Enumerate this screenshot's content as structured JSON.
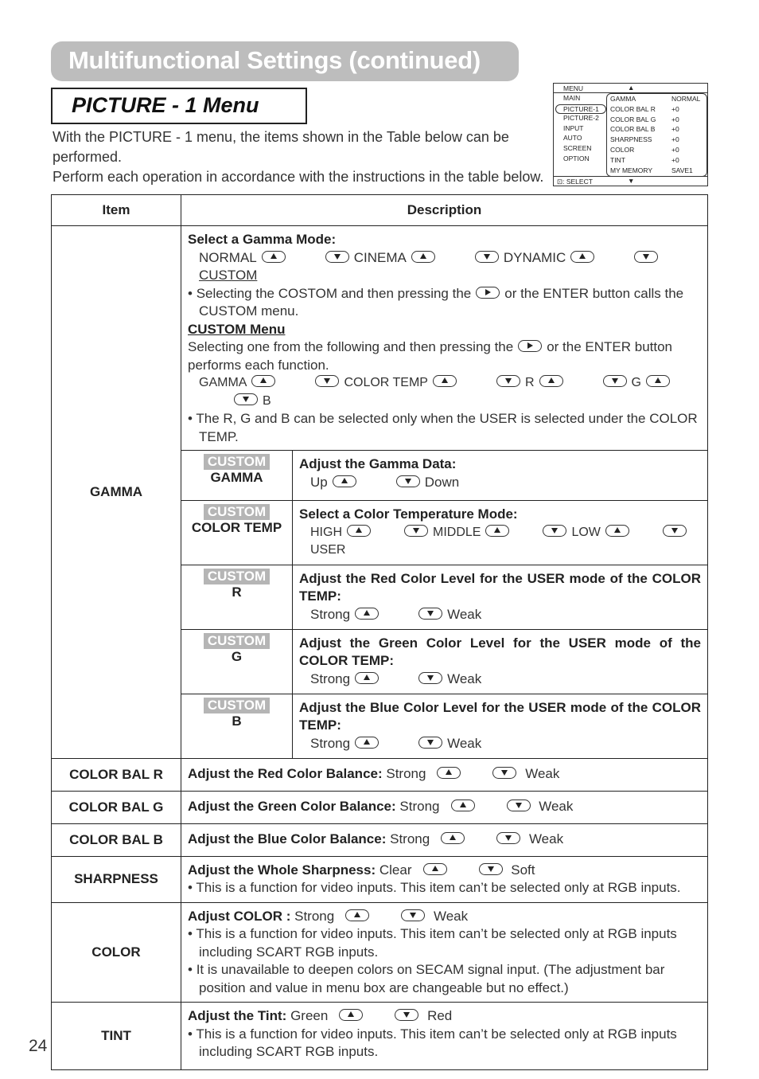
{
  "page": {
    "title": "Multifunctional Settings (continued)",
    "subtitle": "PICTURE - 1 Menu",
    "intro": [
      "With the PICTURE - 1 menu, the items shown in the Table below can be performed.",
      "Perform each operation in accordance with the instructions in the table below."
    ],
    "page_number": "24"
  },
  "osd_menu": {
    "header": "MENU",
    "up_arrow": "▲",
    "down_arrow": "▼",
    "footer": ": SELECT",
    "left_items": [
      "MAIN",
      "PICTURE-1",
      "PICTURE-2",
      "INPUT",
      "AUTO",
      "SCREEN",
      "OPTION"
    ],
    "selected_left": "PICTURE-1",
    "right_items": [
      {
        "key": "GAMMA",
        "value": "NORMAL"
      },
      {
        "key": "COLOR BAL R",
        "value": "+0"
      },
      {
        "key": "COLOR BAL G",
        "value": "+0"
      },
      {
        "key": "COLOR BAL B",
        "value": "+0"
      },
      {
        "key": "SHARPNESS",
        "value": "+0"
      },
      {
        "key": "COLOR",
        "value": "+0"
      },
      {
        "key": "TINT",
        "value": "+0"
      },
      {
        "key": "MY MEMORY",
        "value": "SAVE1"
      }
    ]
  },
  "table": {
    "headers": {
      "item": "Item",
      "description": "Description"
    },
    "gamma": {
      "item": "GAMMA",
      "select_title": "Select a Gamma Mode:",
      "modes": [
        "NORMAL",
        "CINEMA",
        "DYNAMIC",
        "CUSTOM"
      ],
      "note1_a": "Selecting the COSTOM and then pressing the",
      "note1_b": "or the ENTER button calls the CUSTOM menu.",
      "custom_menu_title": "CUSTOM Menu",
      "custom_text_a": "Selecting one from the following and then pressing the",
      "custom_text_b": "or the ENTER button performs each function.",
      "custom_items": [
        "GAMMA",
        "COLOR TEMP",
        "R",
        "G",
        "B"
      ],
      "note2": "The R, G and B can be selected only when the USER is selected under the COLOR TEMP.",
      "custom_tag": "CUSTOM",
      "sub_rows": [
        {
          "item": "GAMMA",
          "title": "Adjust the Gamma Data:",
          "up": "Up",
          "down": "Down"
        },
        {
          "item": "COLOR TEMP",
          "title": "Select a Color Temperature Mode:",
          "modes": [
            "HIGH",
            "MIDDLE",
            "LOW",
            "USER"
          ]
        },
        {
          "item": "R",
          "title": "Adjust the Red Color Level for the USER mode of the COLOR TEMP:",
          "up": "Strong",
          "down": "Weak"
        },
        {
          "item": "G",
          "title": "Adjust the Green Color Level for the USER mode of the COLOR TEMP:",
          "up": "Strong",
          "down": "Weak"
        },
        {
          "item": "B",
          "title": "Adjust the Blue Color Level for the USER mode of the COLOR TEMP:",
          "up": "Strong",
          "down": "Weak"
        }
      ]
    },
    "rows": [
      {
        "item": "COLOR BAL R",
        "title": "Adjust the Red Color Balance:",
        "up": "Strong",
        "down": "Weak"
      },
      {
        "item": "COLOR BAL G",
        "title": "Adjust the Green Color Balance:",
        "up": "Strong",
        "down": "Weak"
      },
      {
        "item": "COLOR BAL B",
        "title": "Adjust the Blue Color Balance:",
        "up": "Strong",
        "down": "Weak"
      },
      {
        "item": "SHARPNESS",
        "title": "Adjust the Whole Sharpness:",
        "up": "Clear",
        "down": "Soft",
        "notes": [
          "This is a function for video inputs. This item can’t be selected only at RGB inputs."
        ]
      },
      {
        "item": "COLOR",
        "title": "Adjust COLOR :",
        "up": "Strong",
        "down": "Weak",
        "notes": [
          "This is a function for video inputs. This item can’t be selected only at  RGB inputs including SCART RGB inputs.",
          "It is unavailable to deepen colors on SECAM signal input. (The adjustment bar position and value in menu box are changeable but no effect.)"
        ]
      },
      {
        "item": "TINT",
        "title": "Adjust the Tint:",
        "up": "Green",
        "down": "Red",
        "notes": [
          " This is a function for video inputs. This item can’t be selected only at  RGB inputs including SCART RGB inputs."
        ]
      }
    ]
  }
}
